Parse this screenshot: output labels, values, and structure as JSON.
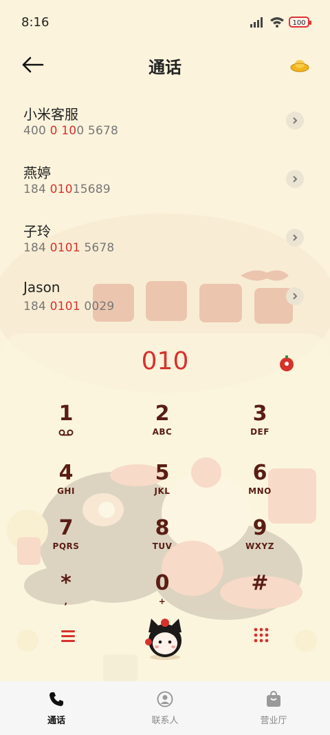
{
  "status": {
    "time": "8:16",
    "battery": "100"
  },
  "header": {
    "title": "通话"
  },
  "contacts": [
    {
      "name": "小米客服",
      "num_pre": "400 ",
      "num_hl": "0 10",
      "num_post": "0 5678"
    },
    {
      "name": "燕婷",
      "num_pre": "184 ",
      "num_hl": "010",
      "num_post": "15689"
    },
    {
      "name": "子玲",
      "num_pre": "184 ",
      "num_hl": "0101",
      "num_post": " 5678"
    },
    {
      "name": "Jason",
      "num_pre": "184 ",
      "num_hl": "0101",
      "num_post": " 0029"
    }
  ],
  "dialpad": {
    "number": "010",
    "keys": [
      {
        "digit": "1",
        "sub": ""
      },
      {
        "digit": "2",
        "sub": "ABC"
      },
      {
        "digit": "3",
        "sub": "DEF"
      },
      {
        "digit": "4",
        "sub": "GHI"
      },
      {
        "digit": "5",
        "sub": "JKL"
      },
      {
        "digit": "6",
        "sub": "MNO"
      },
      {
        "digit": "7",
        "sub": "PQRS"
      },
      {
        "digit": "8",
        "sub": "TUV"
      },
      {
        "digit": "9",
        "sub": "WXYZ"
      },
      {
        "digit": "*",
        "sub": ","
      },
      {
        "digit": "0",
        "sub": "+"
      },
      {
        "digit": "#",
        "sub": ""
      }
    ]
  },
  "tabs": [
    {
      "label": "通话",
      "icon": "phone-icon",
      "active": true
    },
    {
      "label": "联系人",
      "icon": "contact-icon",
      "active": false
    },
    {
      "label": "营业厅",
      "icon": "shop-bag-icon",
      "active": false
    }
  ],
  "colors": {
    "accent": "#d6322c",
    "key_text": "#5a1d14",
    "background": "#fbf3dc"
  }
}
